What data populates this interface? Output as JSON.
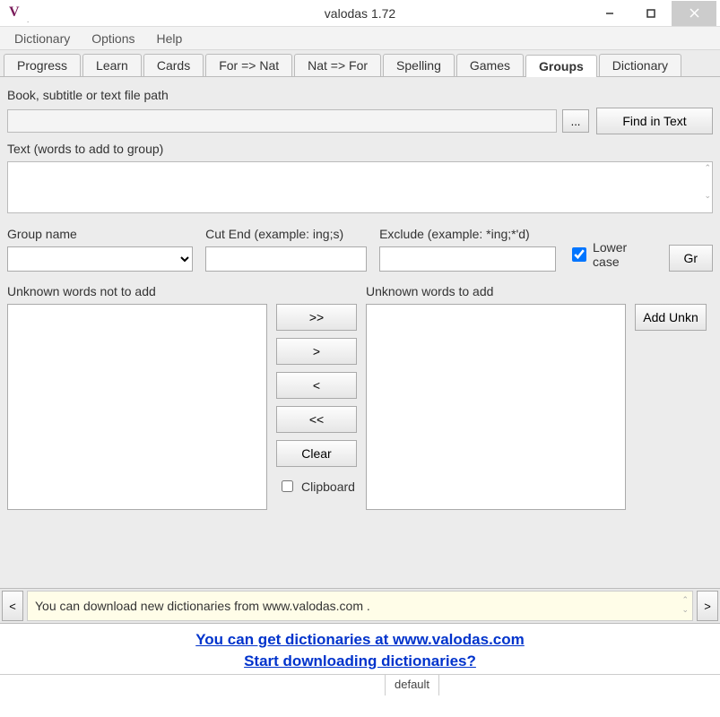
{
  "window": {
    "title": "valodas 1.72",
    "icon_letter": "V"
  },
  "menu": {
    "items": [
      "Dictionary",
      "Options",
      "Help"
    ]
  },
  "tabs": {
    "items": [
      "Progress",
      "Learn",
      "Cards",
      "For => Nat",
      "Nat => For",
      "Spelling",
      "Games",
      "Groups",
      "Dictionary"
    ],
    "active_index": 7
  },
  "groups": {
    "path_label": "Book, subtitle or text file path",
    "browse_label": "...",
    "find_label": "Find in Text",
    "text_label": "Text (words to add to group)",
    "group_name_label": "Group name",
    "cut_end_label": "Cut End (example: ing;s)",
    "exclude_label": "Exclude (example: *ing;*'d)",
    "lower_case_label": "Lower case",
    "lower_case_checked": true,
    "gr_button_label": "Gr",
    "unknown_not_label": "Unknown words not to add",
    "unknown_to_label": "Unknown words to add",
    "btn_move_all_right": ">>",
    "btn_move_right": ">",
    "btn_move_left": "<",
    "btn_move_all_left": "<<",
    "btn_clear": "Clear",
    "clipboard_label": "Clipboard",
    "clipboard_checked": false,
    "add_unknown_label": "Add Unkn"
  },
  "info": {
    "prev": "<",
    "next": ">",
    "message": "You can download new dictionaries from www.valodas.com ."
  },
  "links": {
    "line1": "You can get dictionaries at www.valodas.com",
    "line2": "Start downloading dictionaries?"
  },
  "status": {
    "text": "default"
  }
}
